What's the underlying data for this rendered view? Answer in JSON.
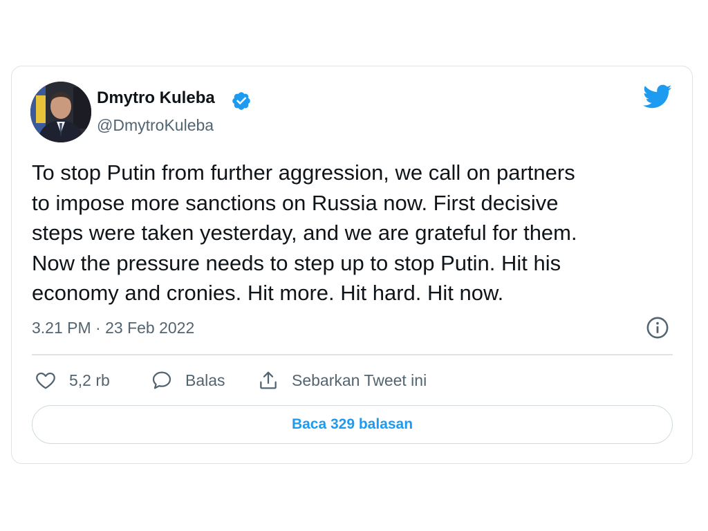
{
  "author": {
    "name": "Dmytro Kuleba",
    "handle": "@DmytroKuleba"
  },
  "tweet": {
    "text_lines": [
      "To stop Putin from further aggression, we call on partners",
      "to impose more sanctions on Russia now. First decisive",
      "steps were taken yesterday, and we are grateful for them.",
      "Now the pressure needs to step up to stop Putin. Hit his",
      "economy and cronies. Hit more. Hit hard. Hit now."
    ],
    "timestamp": "3.21 PM · 23 Feb 2022"
  },
  "actions": {
    "like_count": "5,2 rb",
    "reply_label": "Balas",
    "share_label": "Sebarkan Tweet ini"
  },
  "replies_button": "Baca 329 balasan",
  "icons": {
    "verified": "verified-badge-icon",
    "twitter": "twitter-bird-icon",
    "info": "info-icon",
    "like": "heart-icon",
    "reply": "speech-bubble-icon",
    "share": "share-icon"
  },
  "colors": {
    "accent": "#1d9bf0",
    "text": "#0f1419",
    "secondary": "#536471",
    "border": "#dfe3e6"
  }
}
